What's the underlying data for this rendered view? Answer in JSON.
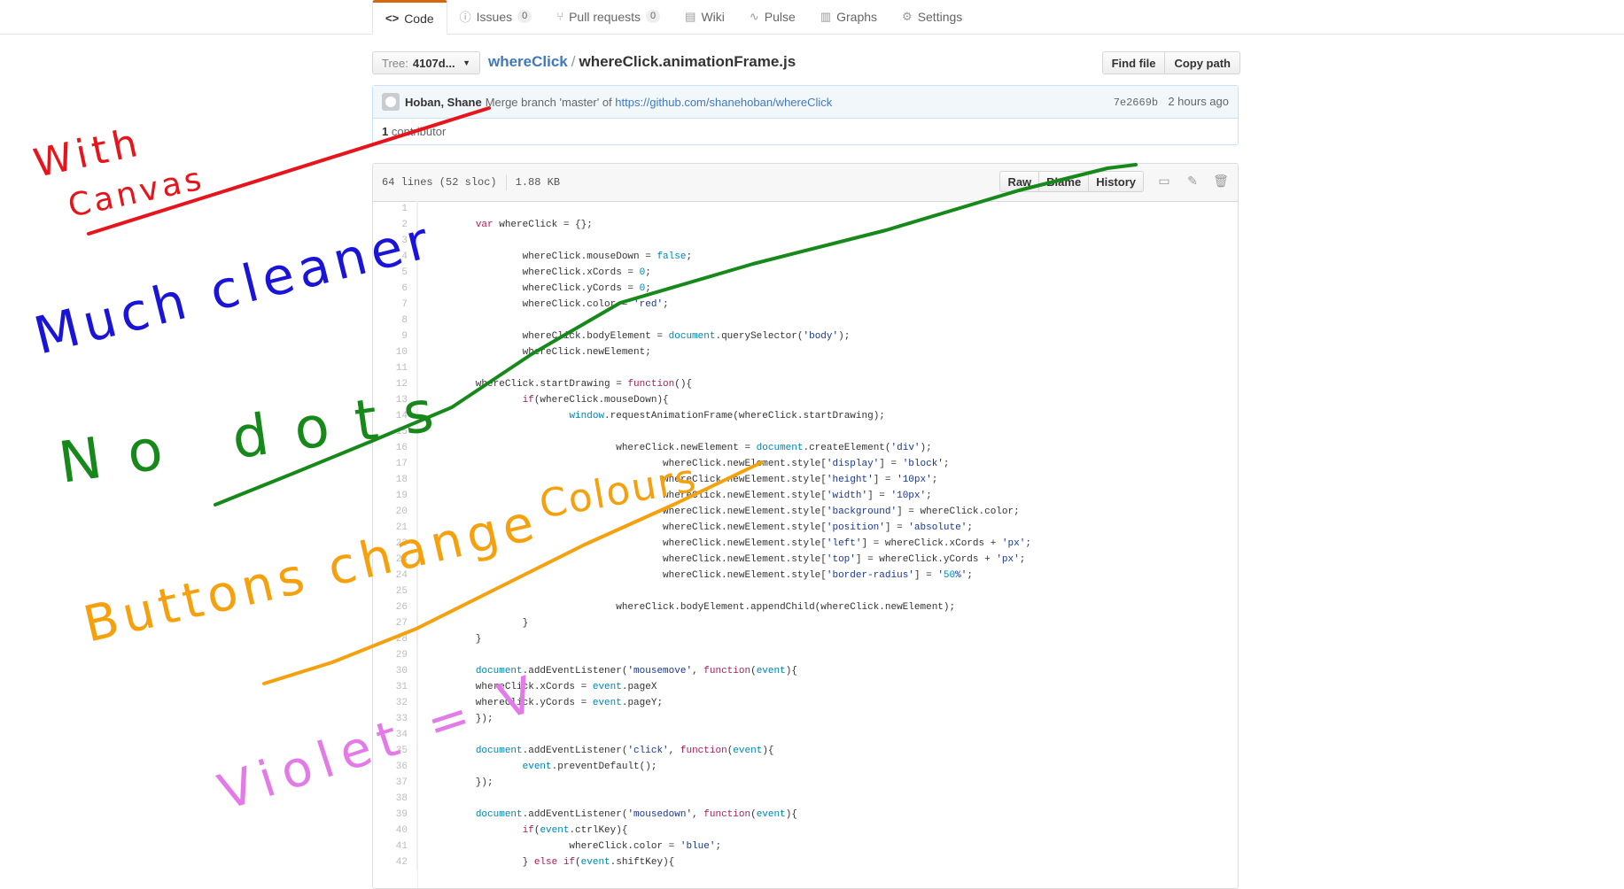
{
  "tabs": [
    {
      "label": "Code",
      "icon": "code-icon",
      "selected": true
    },
    {
      "label": "Issues",
      "icon": "issue-icon",
      "count": "0"
    },
    {
      "label": "Pull requests",
      "icon": "pull-request-icon",
      "count": "0"
    },
    {
      "label": "Wiki",
      "icon": "book-icon"
    },
    {
      "label": "Pulse",
      "icon": "pulse-icon"
    },
    {
      "label": "Graphs",
      "icon": "graph-icon"
    },
    {
      "label": "Settings",
      "icon": "gear-icon"
    }
  ],
  "file_nav": {
    "tree_label": "Tree:",
    "tree_value": "4107d...",
    "repo": "whereClick",
    "separator": "/",
    "file": "whereClick.animationFrame.js",
    "find_file": "Find file",
    "copy_path": "Copy path"
  },
  "commit": {
    "author": "Hoban, Shane",
    "message": "Merge branch 'master' of",
    "link": "https://github.com/shanehoban/whereClick",
    "sha": "7e2669b",
    "time": "2 hours ago",
    "contributor_count": "1",
    "contributor_label": "contributor"
  },
  "file_info": {
    "lines": "64 lines (52 sloc)",
    "size": "1.88 KB",
    "raw": "Raw",
    "blame": "Blame",
    "history": "History"
  },
  "code_lines": [
    "",
    "\tvar whereClick = {};",
    "",
    "\t\twhereClick.mouseDown = false;",
    "\t\twhereClick.xCords = 0;",
    "\t\twhereClick.yCords = 0;",
    "\t\twhereClick.color = 'red';",
    "",
    "\t\twhereClick.bodyElement = document.querySelector('body');",
    "\t\twhereClick.newElement;",
    "",
    "\twhereClick.startDrawing = function(){",
    "\t\tif(whereClick.mouseDown){",
    "\t\t\twindow.requestAnimationFrame(whereClick.startDrawing);",
    "",
    "\t\t\t\twhereClick.newElement = document.createElement('div');",
    "\t\t\t\t\twhereClick.newElement.style['display'] = 'block';",
    "\t\t\t\t\twhereClick.newElement.style['height'] = '10px';",
    "\t\t\t\t\twhereClick.newElement.style['width'] = '10px';",
    "\t\t\t\t\twhereClick.newElement.style['background'] = whereClick.color;",
    "\t\t\t\t\twhereClick.newElement.style['position'] = 'absolute';",
    "\t\t\t\t\twhereClick.newElement.style['left'] = whereClick.xCords + 'px';",
    "\t\t\t\t\twhereClick.newElement.style['top'] = whereClick.yCords + 'px';",
    "\t\t\t\t\twhereClick.newElement.style['border-radius'] = '50%';",
    "",
    "\t\t\t\twhereClick.bodyElement.appendChild(whereClick.newElement);",
    "\t\t}",
    "\t}",
    "",
    "\tdocument.addEventListener('mousemove', function(event){",
    "\twhereClick.xCords = event.pageX",
    "\twhereClick.yCords = event.pageY;",
    "\t});",
    "",
    "\tdocument.addEventListener('click', function(event){",
    "\t\tevent.preventDefault();",
    "\t});",
    "",
    "\tdocument.addEventListener('mousedown', function(event){",
    "\t\tif(event.ctrlKey){",
    "\t\t\twhereClick.color = 'blue';",
    "\t\t} else if(event.shiftKey){"
  ],
  "annotations": [
    {
      "text": "With",
      "color": "#e8141b"
    },
    {
      "text": "Canvas",
      "color": "#e8141b"
    },
    {
      "text": "Much cleaner",
      "color": "#1a14d8"
    },
    {
      "text": "No dots",
      "color": "#16891a"
    },
    {
      "text": "Colours",
      "color": "#f5a10e"
    },
    {
      "text": "Buttons change",
      "color": "#f5a10e"
    },
    {
      "text": "Violet = V",
      "color": "#e27be8"
    }
  ],
  "colors": {
    "accent_tab": "#d26911",
    "link": "#4078c0",
    "commit_bg": "#f2f8fa"
  }
}
